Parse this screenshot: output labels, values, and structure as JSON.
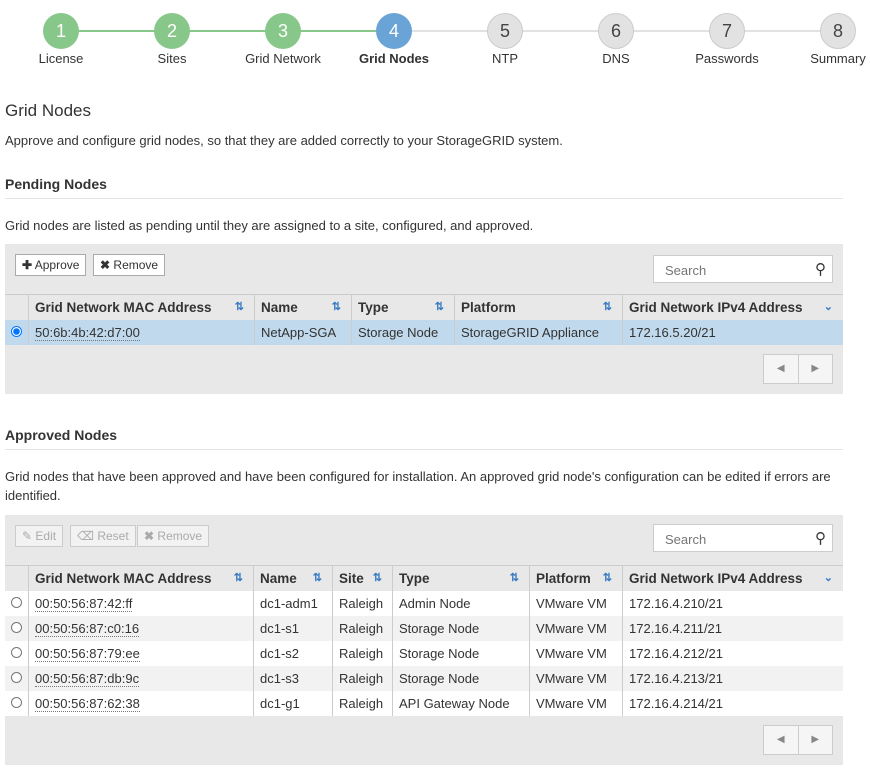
{
  "steps": [
    {
      "n": "1",
      "label": "License",
      "state": "done"
    },
    {
      "n": "2",
      "label": "Sites",
      "state": "done"
    },
    {
      "n": "3",
      "label": "Grid Network",
      "state": "done"
    },
    {
      "n": "4",
      "label": "Grid Nodes",
      "state": "active"
    },
    {
      "n": "5",
      "label": "NTP",
      "state": "todo"
    },
    {
      "n": "6",
      "label": "DNS",
      "state": "todo"
    },
    {
      "n": "7",
      "label": "Passwords",
      "state": "todo"
    },
    {
      "n": "8",
      "label": "Summary",
      "state": "todo"
    }
  ],
  "colors": {
    "done": "#88c78a",
    "active": "#6aa3d5",
    "todo": "#e2e2e2"
  },
  "title": "Grid Nodes",
  "intro": "Approve and configure grid nodes, so that they are added correctly to your StorageGRID system.",
  "pending": {
    "heading": "Pending Nodes",
    "desc": "Grid nodes are listed as pending until they are assigned to a site, configured, and approved.",
    "approve": "Approve",
    "remove": "Remove",
    "search_placeholder": "Search",
    "columns": [
      "Grid Network MAC Address",
      "Name",
      "Type",
      "Platform",
      "Grid Network IPv4 Address"
    ],
    "rows": [
      [
        "50:6b:4b:42:d7:00",
        "NetApp-SGA",
        "Storage Node",
        "StorageGRID Appliance",
        "172.16.5.20/21"
      ]
    ]
  },
  "approved": {
    "heading": "Approved Nodes",
    "desc": "Grid nodes that have been approved and have been configured for installation. An approved grid node's configuration can be edited if errors are identified.",
    "edit": "Edit",
    "reset": "Reset",
    "remove": "Remove",
    "search_placeholder": "Search",
    "columns": [
      "Grid Network MAC Address",
      "Name",
      "Site",
      "Type",
      "Platform",
      "Grid Network IPv4 Address"
    ],
    "rows": [
      [
        "00:50:56:87:42:ff",
        "dc1-adm1",
        "Raleigh",
        "Admin Node",
        "VMware VM",
        "172.16.4.210/21"
      ],
      [
        "00:50:56:87:c0:16",
        "dc1-s1",
        "Raleigh",
        "Storage Node",
        "VMware VM",
        "172.16.4.211/21"
      ],
      [
        "00:50:56:87:79:ee",
        "dc1-s2",
        "Raleigh",
        "Storage Node",
        "VMware VM",
        "172.16.4.212/21"
      ],
      [
        "00:50:56:87:db:9c",
        "dc1-s3",
        "Raleigh",
        "Storage Node",
        "VMware VM",
        "172.16.4.213/21"
      ],
      [
        "00:50:56:87:62:38",
        "dc1-g1",
        "Raleigh",
        "API Gateway Node",
        "VMware VM",
        "172.16.4.214/21"
      ]
    ]
  }
}
